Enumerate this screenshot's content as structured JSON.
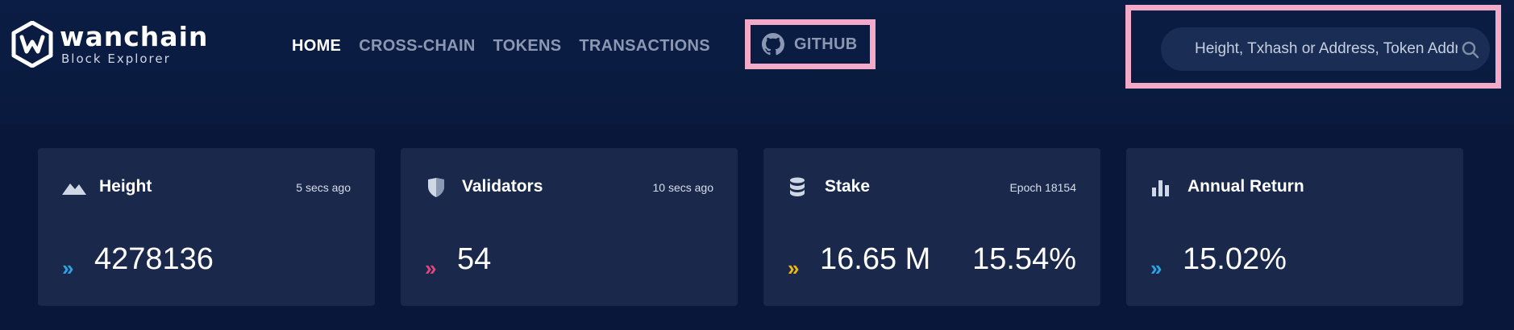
{
  "brand": {
    "name": "wanchain",
    "subtitle": "Block Explorer"
  },
  "nav": {
    "items": [
      {
        "label": "HOME",
        "active": true
      },
      {
        "label": "CROSS-CHAIN",
        "active": false
      },
      {
        "label": "TOKENS",
        "active": false
      },
      {
        "label": "TRANSACTIONS",
        "active": false
      }
    ],
    "github_label": "GITHUB"
  },
  "search": {
    "placeholder": "Height, Txhash or Address, Token Address",
    "value": ""
  },
  "cards": [
    {
      "icon": "mountain-icon",
      "title": "Height",
      "meta": "5 secs ago",
      "value": "4278136",
      "chevron_color": "#2aa6e8"
    },
    {
      "icon": "shield-icon",
      "title": "Validators",
      "meta": "10 secs ago",
      "value": "54",
      "chevron_color": "#e4457a"
    },
    {
      "icon": "database-icon",
      "title": "Stake",
      "meta": "Epoch 18154",
      "value": "16.65 M",
      "value2": "15.54%",
      "chevron_color": "#f0b90b"
    },
    {
      "icon": "bar-chart-icon",
      "title": "Annual Return",
      "meta": "",
      "value": "15.02%",
      "chevron_color": "#2aa6e8"
    }
  ],
  "colors": {
    "background": "#0a1a3c",
    "card": "#1a294b",
    "highlight_border": "#f3a9c8",
    "nav_inactive": "#8a98b3"
  }
}
